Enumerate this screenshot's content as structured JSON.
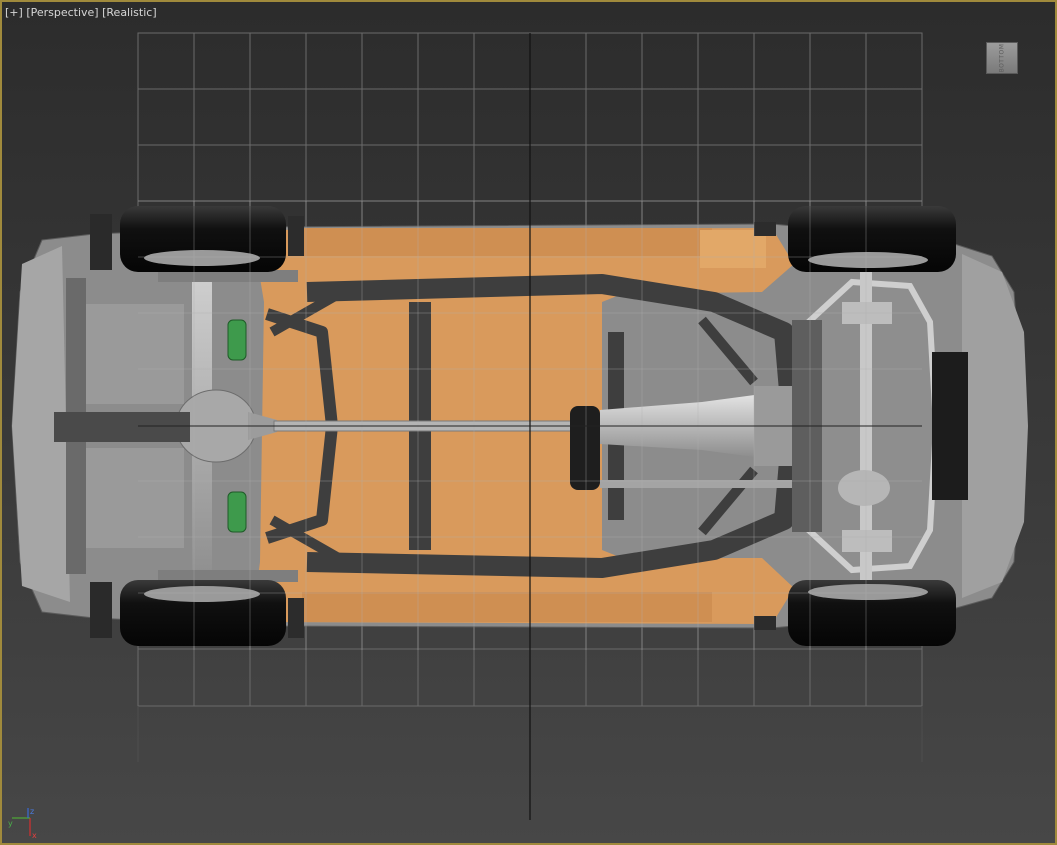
{
  "viewport": {
    "label_plus": "[+]",
    "label_view": "[Perspective]",
    "label_shading": "[Realistic]"
  },
  "viewcube": {
    "face_label": "BOTTOM"
  },
  "axis_gizmo": {
    "x": "x",
    "y": "y",
    "z": "z"
  },
  "colors": {
    "border_active": "#a08a3c",
    "body_paint": "#d99a5c",
    "frame": "#3f3f3f",
    "tire": "#141414",
    "grid": "#6e6e6e"
  }
}
